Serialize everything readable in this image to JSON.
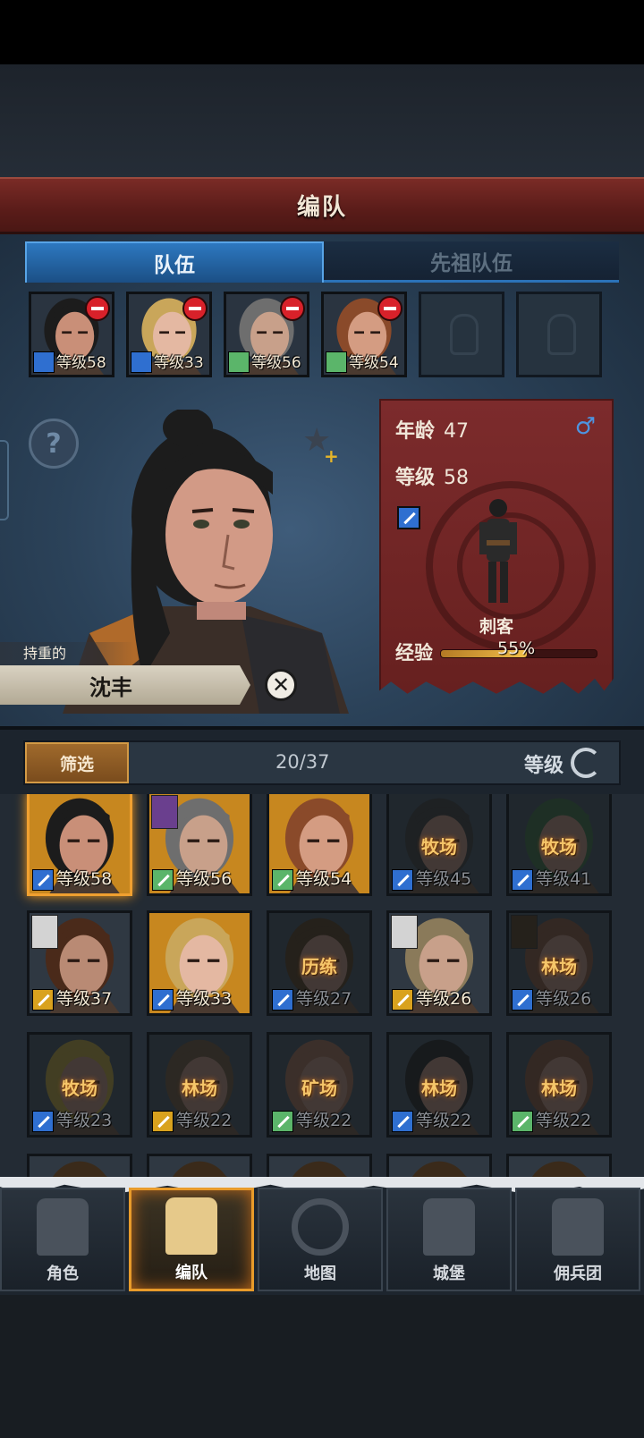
{
  "title": "编队",
  "tabs": [
    {
      "label": "队伍",
      "active": true
    },
    {
      "label": "先祖队伍",
      "active": false
    }
  ],
  "team_slots": [
    {
      "level": "等级58",
      "class_icon": "sword-icon",
      "class_color": "#2f6fd0",
      "hair": "#1c1c1c",
      "skin": "#c98f78"
    },
    {
      "level": "等级33",
      "class_icon": "sword-icon",
      "class_color": "#2f6fd0",
      "hair": "#c9a65a",
      "skin": "#e4b8a2"
    },
    {
      "level": "等级56",
      "class_icon": "crossed-swords-icon",
      "class_color": "#5bb56a",
      "hair": "#6e6e6e",
      "skin": "#c8a08a"
    },
    {
      "level": "等级54",
      "class_icon": "crossed-swords-icon",
      "class_color": "#5bb56a",
      "hair": "#8a4a2a",
      "skin": "#d49c82"
    }
  ],
  "empty_slots": 2,
  "hero": {
    "trait": "持重的",
    "name": "沈丰",
    "age_label": "年龄",
    "age": "47",
    "level_label": "等级",
    "level": "58",
    "role": "刺客",
    "exp_label": "经验",
    "exp_percent": "55%",
    "exp_fraction": 0.55,
    "gender_icon": "male-icon"
  },
  "filter": {
    "button": "筛选",
    "count": "20/37",
    "sort": "等级"
  },
  "roster": [
    {
      "level": "等级58",
      "cls": "sword",
      "bg": "gold",
      "selected": true,
      "job": "",
      "hair": "#1c1c1c",
      "skin": "#c98f78"
    },
    {
      "level": "等级56",
      "cls": "shield",
      "bg": "gold",
      "selected": false,
      "job": "",
      "hair": "#6e6e6e",
      "skin": "#c8a08a",
      "badge": "purple"
    },
    {
      "level": "等级54",
      "cls": "shield",
      "bg": "gold",
      "selected": false,
      "job": "",
      "hair": "#8a4a2a",
      "skin": "#d49c82"
    },
    {
      "level": "等级45",
      "cls": "sword",
      "bg": "dark",
      "selected": false,
      "job": "牧场",
      "hair": "#2a2a2a",
      "skin": "#7a5e52"
    },
    {
      "level": "等级41",
      "cls": "sword",
      "bg": "dark",
      "selected": false,
      "job": "牧场",
      "hair": "#2c4a30",
      "skin": "#7a5e52"
    },
    {
      "level": "等级37",
      "cls": "gold",
      "bg": "dark",
      "selected": false,
      "job": "",
      "hair": "#4a2a1a",
      "skin": "#b98a74",
      "badge": "white"
    },
    {
      "level": "等级33",
      "cls": "sword",
      "bg": "gold",
      "selected": false,
      "job": "",
      "hair": "#c9a65a",
      "skin": "#e4b8a2"
    },
    {
      "level": "等级27",
      "cls": "sword",
      "bg": "dark",
      "selected": false,
      "job": "历练",
      "hair": "#3a2a1a",
      "skin": "#7a5e52"
    },
    {
      "level": "等级26",
      "cls": "gold",
      "bg": "dark",
      "selected": false,
      "job": "",
      "hair": "#8a7a5a",
      "skin": "#c8a08a",
      "badge": "white"
    },
    {
      "level": "等级26",
      "cls": "sword",
      "bg": "dark",
      "selected": false,
      "job": "林场",
      "hair": "#5a3a2a",
      "skin": "#7a5e52",
      "badge": "dark"
    },
    {
      "level": "等级23",
      "cls": "sword",
      "bg": "dark",
      "selected": false,
      "job": "牧场",
      "hair": "#7a6a2a",
      "skin": "#7a5e52"
    },
    {
      "level": "等级22",
      "cls": "gold",
      "bg": "dark",
      "selected": false,
      "job": "林场",
      "hair": "#4a3a2a",
      "skin": "#7a5e52"
    },
    {
      "level": "等级22",
      "cls": "shield",
      "bg": "dark",
      "selected": false,
      "job": "矿场",
      "hair": "#6a4a3a",
      "skin": "#7a5e52"
    },
    {
      "level": "等级22",
      "cls": "sword",
      "bg": "dark",
      "selected": false,
      "job": "林场",
      "hair": "#1c1c1c",
      "skin": "#7a5e52"
    },
    {
      "level": "等级22",
      "cls": "shield",
      "bg": "dark",
      "selected": false,
      "job": "林场",
      "hair": "#5a3a2a",
      "skin": "#7a5e52"
    }
  ],
  "nav": [
    {
      "label": "角色",
      "icon": "knight-icon",
      "active": false
    },
    {
      "label": "编队",
      "icon": "helmet-icon",
      "active": true
    },
    {
      "label": "地图",
      "icon": "compass-map-icon",
      "active": false
    },
    {
      "label": "城堡",
      "icon": "castle-icon",
      "active": false
    },
    {
      "label": "佣兵团",
      "icon": "mercenary-banner-icon",
      "active": false
    }
  ]
}
